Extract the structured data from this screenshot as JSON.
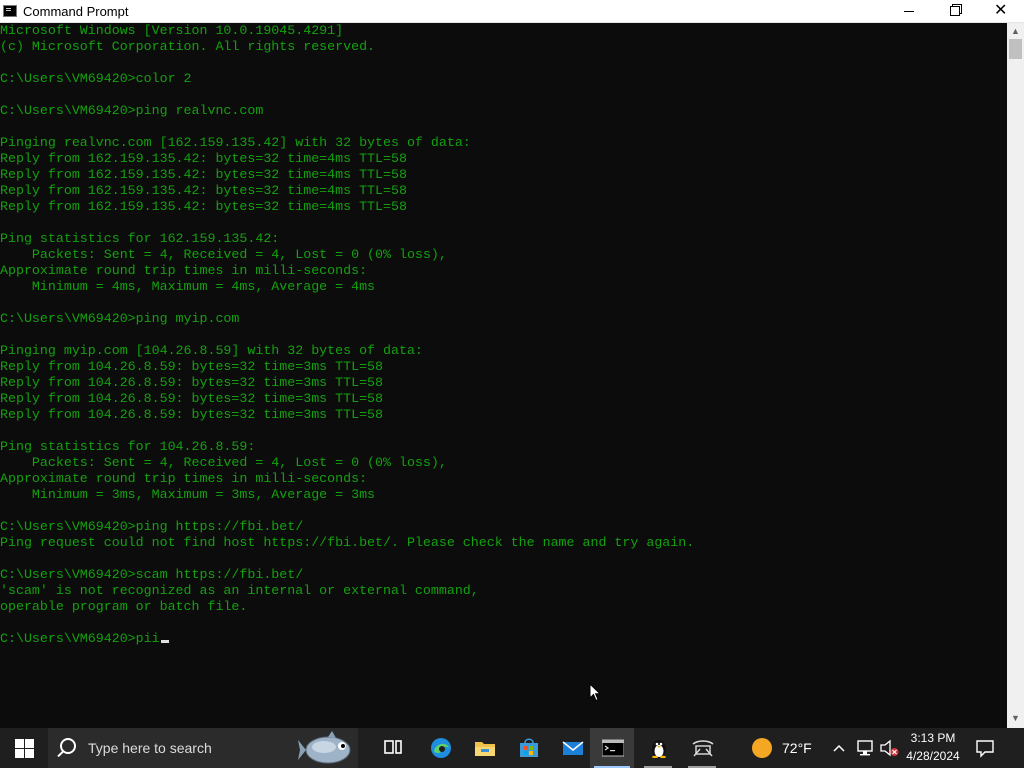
{
  "window": {
    "title": "Command Prompt",
    "minimize_icon": "minimize-icon",
    "maximize_icon": "restore-icon",
    "close_icon": "close-icon"
  },
  "console": {
    "text_color": "#13a10e",
    "background": "#0c0c0c",
    "lines": [
      "Microsoft Windows [Version 10.0.19045.4291]",
      "(c) Microsoft Corporation. All rights reserved.",
      "",
      "C:\\Users\\VM69420>color 2",
      "",
      "C:\\Users\\VM69420>ping realvnc.com",
      "",
      "Pinging realvnc.com [162.159.135.42] with 32 bytes of data:",
      "Reply from 162.159.135.42: bytes=32 time=4ms TTL=58",
      "Reply from 162.159.135.42: bytes=32 time=4ms TTL=58",
      "Reply from 162.159.135.42: bytes=32 time=4ms TTL=58",
      "Reply from 162.159.135.42: bytes=32 time=4ms TTL=58",
      "",
      "Ping statistics for 162.159.135.42:",
      "    Packets: Sent = 4, Received = 4, Lost = 0 (0% loss),",
      "Approximate round trip times in milli-seconds:",
      "    Minimum = 4ms, Maximum = 4ms, Average = 4ms",
      "",
      "C:\\Users\\VM69420>ping myip.com",
      "",
      "Pinging myip.com [104.26.8.59] with 32 bytes of data:",
      "Reply from 104.26.8.59: bytes=32 time=3ms TTL=58",
      "Reply from 104.26.8.59: bytes=32 time=3ms TTL=58",
      "Reply from 104.26.8.59: bytes=32 time=3ms TTL=58",
      "Reply from 104.26.8.59: bytes=32 time=3ms TTL=58",
      "",
      "Ping statistics for 104.26.8.59:",
      "    Packets: Sent = 4, Received = 4, Lost = 0 (0% loss),",
      "Approximate round trip times in milli-seconds:",
      "    Minimum = 3ms, Maximum = 3ms, Average = 3ms",
      "",
      "C:\\Users\\VM69420>ping https://fbi.bet/",
      "Ping request could not find host https://fbi.bet/. Please check the name and try again.",
      "",
      "C:\\Users\\VM69420>scam https://fbi.bet/",
      "'scam' is not recognized as an internal or external command,",
      "operable program or batch file.",
      ""
    ],
    "prompt": "C:\\Users\\VM69420>",
    "current_input": "pii"
  },
  "taskbar": {
    "start_icon": "windows-logo-icon",
    "search_placeholder": "Type here to search",
    "pinned": [
      {
        "name": "task-view-icon"
      },
      {
        "name": "edge-icon"
      },
      {
        "name": "file-explorer-icon"
      },
      {
        "name": "microsoft-store-icon"
      },
      {
        "name": "mail-icon"
      },
      {
        "name": "command-prompt-icon"
      },
      {
        "name": "linux-penguin-icon"
      },
      {
        "name": "vnc-icon"
      }
    ],
    "weather": {
      "temperature": "72°F",
      "icon": "sun-icon"
    },
    "clock": {
      "time": "3:13 PM",
      "date": "4/28/2024"
    }
  }
}
